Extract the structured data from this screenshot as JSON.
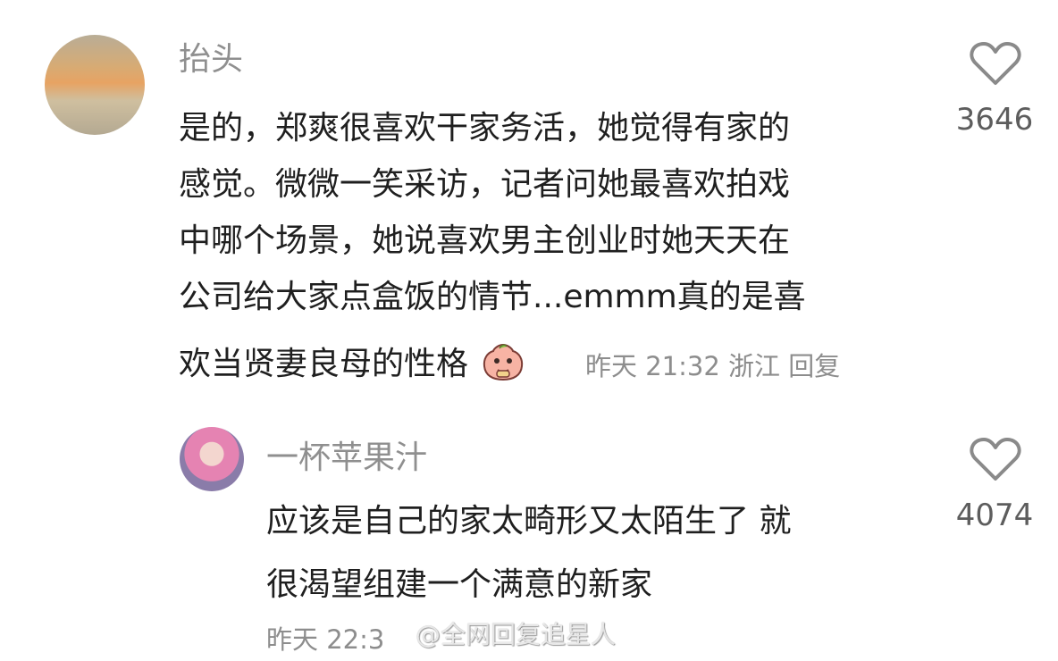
{
  "comments": [
    {
      "username": "抬头",
      "lines": [
        "是的，郑爽很喜欢干家务活，她觉得有家的",
        "感觉。微微一笑采访，记者问她最喜欢拍戏",
        "中哪个场景，她说喜欢男主创业时她天天在",
        "公司给大家点盒饭的情节...emmm真的是喜",
        "欢当贤妻良母的性格"
      ],
      "meta": "昨天 21:32 浙江 回复",
      "likes": "3646",
      "emoji": "embarrassed-peach-sticker"
    },
    {
      "username": "一杯苹果汁",
      "lines": [
        "应该是自己的家太畸形又太陌生了 就",
        "很渴望组建一个满意的新家"
      ],
      "meta": "昨天 22:3",
      "likes": "4074"
    }
  ],
  "watermark": "@全网回复追星人",
  "colors": {
    "text": "#1f1f1f",
    "muted": "#8f8f8f",
    "like_icon": "#8a8a8a",
    "sticker_pink": "#f7b3a4"
  },
  "icons": [
    "heart-outline-icon",
    "emoji-sticker-icon"
  ]
}
